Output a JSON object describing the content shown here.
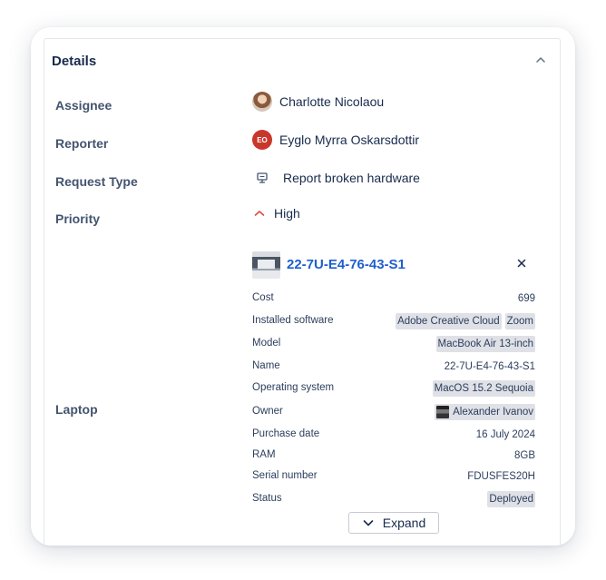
{
  "details": {
    "title": "Details",
    "collapse_icon": "chevron-up-icon"
  },
  "fields": {
    "assignee": {
      "label": "Assignee",
      "value": "Charlotte Nicolaou",
      "avatar_type": "photo"
    },
    "reporter": {
      "label": "Reporter",
      "value": "Eyglo Myrra Oskarsdottir",
      "initials": "EO",
      "avatar_color": "#c9372c"
    },
    "request_type": {
      "label": "Request Type",
      "value": "Report broken hardware",
      "icon": "monitor-icon"
    },
    "priority": {
      "label": "Priority",
      "value": "High",
      "icon": "chevron-up-icon",
      "color": "#e2483d"
    },
    "laptop": {
      "label": "Laptop"
    }
  },
  "asset": {
    "title": "22-7U-E4-76-43-S1",
    "close_icon": "close-icon",
    "link_color": "#1f5fcf",
    "attributes": [
      {
        "name": "Cost",
        "values": [
          "699"
        ],
        "type": "text"
      },
      {
        "name": "Installed software",
        "values": [
          "Adobe Creative Cloud",
          "Zoom"
        ],
        "type": "chip"
      },
      {
        "name": "Model",
        "values": [
          "MacBook Air 13-inch"
        ],
        "type": "chip"
      },
      {
        "name": "Name",
        "values": [
          "22-7U-E4-76-43-S1"
        ],
        "type": "text"
      },
      {
        "name": "Operating system",
        "values": [
          "MacOS 15.2 Sequoia"
        ],
        "type": "chip"
      },
      {
        "name": "Owner",
        "values": [
          "Alexander Ivanov"
        ],
        "type": "user-chip"
      },
      {
        "name": "Purchase date",
        "values": [
          "16 July 2024"
        ],
        "type": "text"
      },
      {
        "name": "RAM",
        "values": [
          "8GB"
        ],
        "type": "text"
      },
      {
        "name": "Serial number",
        "values": [
          "FDUSFES20H"
        ],
        "type": "text"
      },
      {
        "name": "Status",
        "values": [
          "Deployed"
        ],
        "type": "chip"
      }
    ]
  },
  "expand": {
    "label": "Expand",
    "icon": "chevron-down-icon"
  }
}
